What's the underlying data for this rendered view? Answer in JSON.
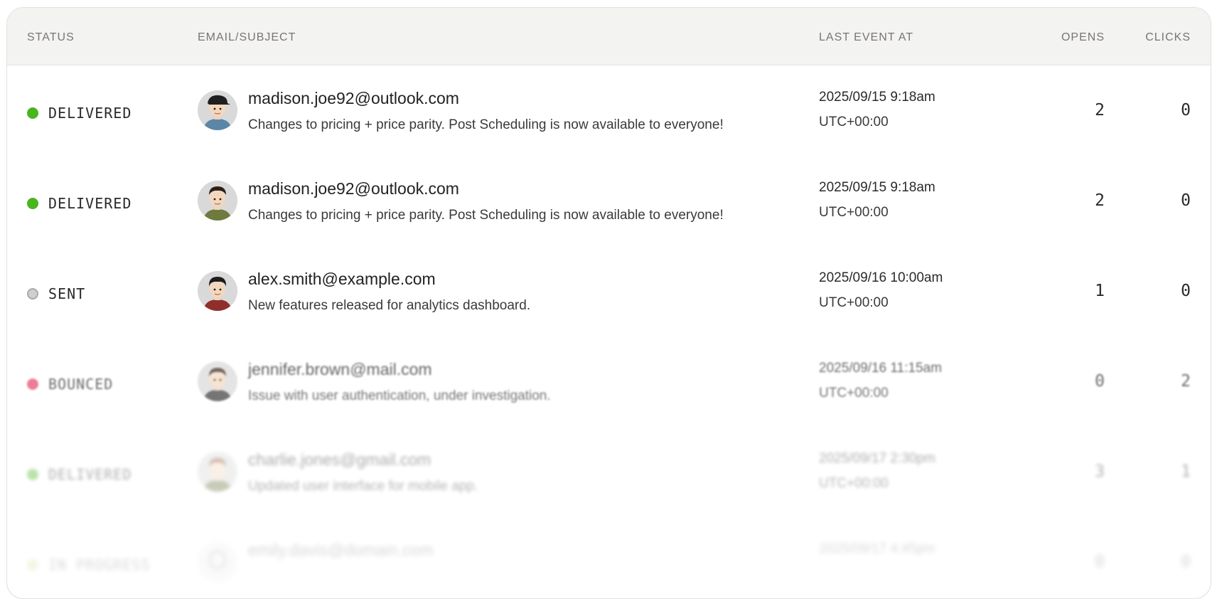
{
  "table": {
    "headers": {
      "status": "STATUS",
      "email_subject": "EMAIL/SUBJECT",
      "last_event_at": "LAST EVENT AT",
      "opens": "OPENS",
      "clicks": "CLICKS"
    },
    "rows": [
      {
        "status": "DELIVERED",
        "status_color": "#49b51f",
        "avatar_icon": "avatar-cap-man",
        "email": "madison.joe92@outlook.com",
        "subject": "Changes to pricing + price parity. Post Scheduling is now available to everyone!",
        "date": "2025/09/15 9:18am",
        "timezone": "UTC+00:00",
        "opens": "2",
        "clicks": "0"
      },
      {
        "status": "DELIVERED",
        "status_color": "#49b51f",
        "avatar_icon": "avatar-man-green-shirt",
        "email": "madison.joe92@outlook.com",
        "subject": "Changes to pricing + price parity. Post Scheduling is now available to everyone!",
        "date": "2025/09/15 9:18am",
        "timezone": "UTC+00:00",
        "opens": "2",
        "clicks": "0"
      },
      {
        "status": "SENT",
        "status_color": "#cfcfcf",
        "avatar_icon": "avatar-man-red-shirt",
        "email": "alex.smith@example.com",
        "subject": "New features released for analytics dashboard.",
        "date": "2025/09/16 10:00am",
        "timezone": "UTC+00:00",
        "opens": "1",
        "clicks": "0"
      },
      {
        "status": "BOUNCED",
        "status_color": "#e8466f",
        "avatar_icon": "avatar-man-dark-shirt",
        "email": "jennifer.brown@mail.com",
        "subject": "Issue with user authentication, under investigation.",
        "date": "2025/09/16 11:15am",
        "timezone": "UTC+00:00",
        "opens": "0",
        "clicks": "2"
      },
      {
        "status": "DELIVERED",
        "status_color": "#49b51f",
        "avatar_icon": "avatar-man-olive-shirt",
        "email": "charlie.jones@gmail.com",
        "subject": "Updated user interface for mobile app.",
        "date": "2025/09/17 2:30pm",
        "timezone": "UTC+00:00",
        "opens": "3",
        "clicks": "1"
      },
      {
        "status": "IN PROGRESS",
        "status_color": "#c9c36a",
        "avatar_icon": "avatar-outline",
        "email": "emily.davis@domain.com",
        "subject": "",
        "date": "2025/09/17 4:45pm",
        "timezone": "",
        "opens": "0",
        "clicks": "0"
      }
    ]
  }
}
